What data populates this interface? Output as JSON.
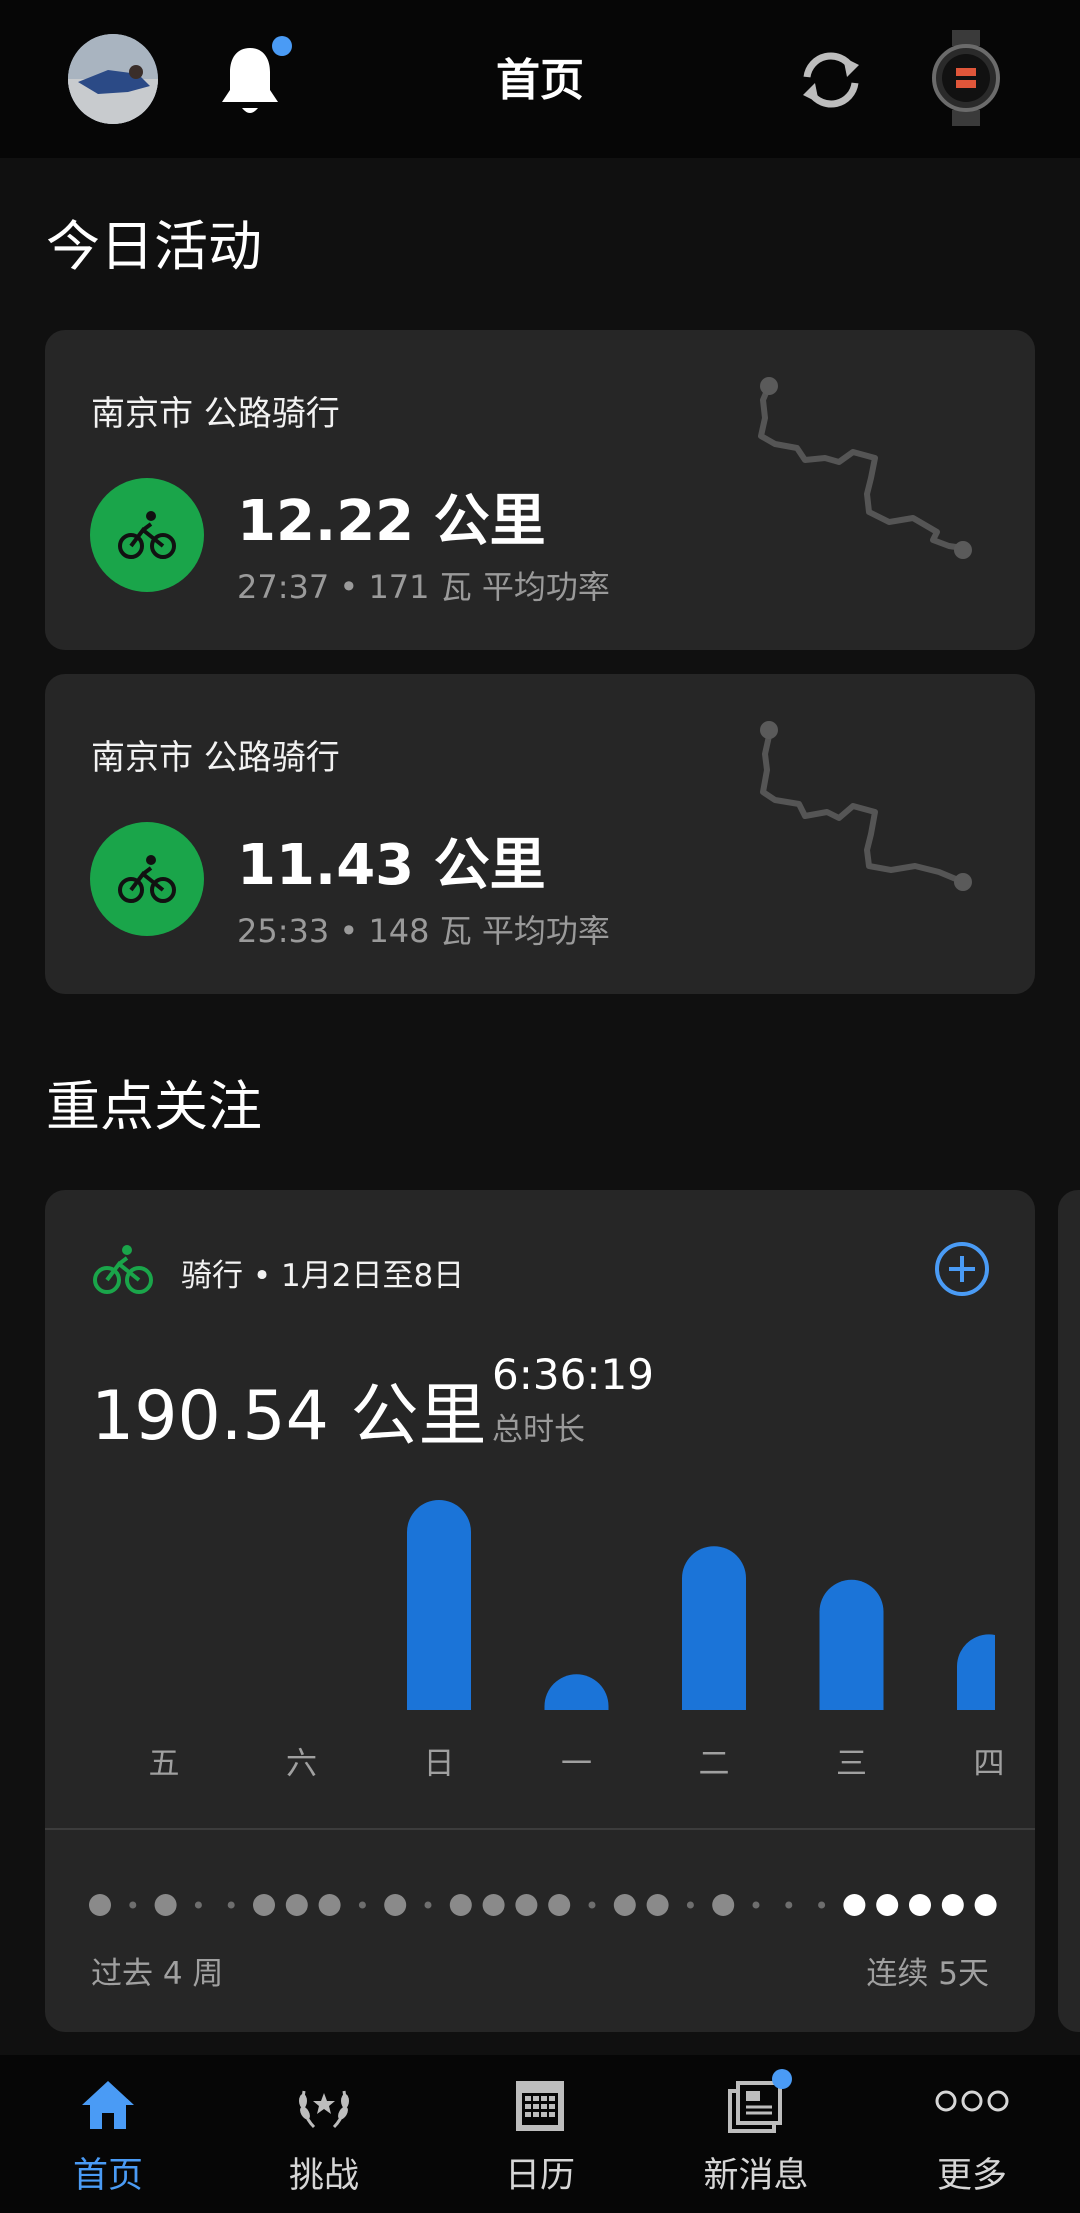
{
  "header": {
    "title": "首页",
    "avatar_icon": "user-avatar",
    "notifications_icon": "bell-icon",
    "sync_icon": "sync-icon",
    "device_icon": "watch-icon",
    "has_unread_notifications": true
  },
  "today": {
    "section_title": "今日活动",
    "activities": [
      {
        "location": "南京市 公路骑行",
        "distance": "12.22 公里",
        "stats": "27:37 • 171 瓦 平均功率",
        "icon": "cycling-icon"
      },
      {
        "location": "南京市 公路骑行",
        "distance": "11.43 公里",
        "stats": "25:33 • 148 瓦 平均功率",
        "icon": "cycling-icon"
      }
    ]
  },
  "highlights": {
    "section_title": "重点关注",
    "card": {
      "title": "骑行 • 1月2日至8日",
      "distance": "190.54 公里",
      "total_time": "6:36:19",
      "total_time_label": "总时长",
      "past_label": "过去 4 周",
      "streak_label": "连续 5天",
      "accent_color": "#1b74d8"
    }
  },
  "chart_data": {
    "type": "bar",
    "categories": [
      "五",
      "六",
      "日",
      "一",
      "二",
      "三",
      "四"
    ],
    "values": [
      0,
      0,
      1.0,
      0.17,
      0.78,
      0.62,
      0.36
    ],
    "ylim": [
      0,
      1
    ],
    "grid": false
  },
  "activity_dots": {
    "days": [
      1,
      0,
      1,
      0,
      0,
      1,
      1,
      1,
      0,
      1,
      0,
      1,
      1,
      1,
      1,
      0,
      1,
      1,
      0,
      1,
      0,
      0,
      0,
      1,
      1,
      1,
      1,
      1
    ],
    "streak_from_index": 23,
    "colors": {
      "active": "#8a8a8a",
      "inactive": "#6e6e6e",
      "streak": "#ffffff"
    }
  },
  "bottom_nav": {
    "items": [
      {
        "label": "首页",
        "icon": "home-icon",
        "active": true
      },
      {
        "label": "挑战",
        "icon": "laurel-icon",
        "active": false
      },
      {
        "label": "日历",
        "icon": "calendar-icon",
        "active": false
      },
      {
        "label": "新消息",
        "icon": "newsfeed-icon",
        "active": false,
        "badge": true
      },
      {
        "label": "更多",
        "icon": "more-icon",
        "active": false
      }
    ]
  }
}
